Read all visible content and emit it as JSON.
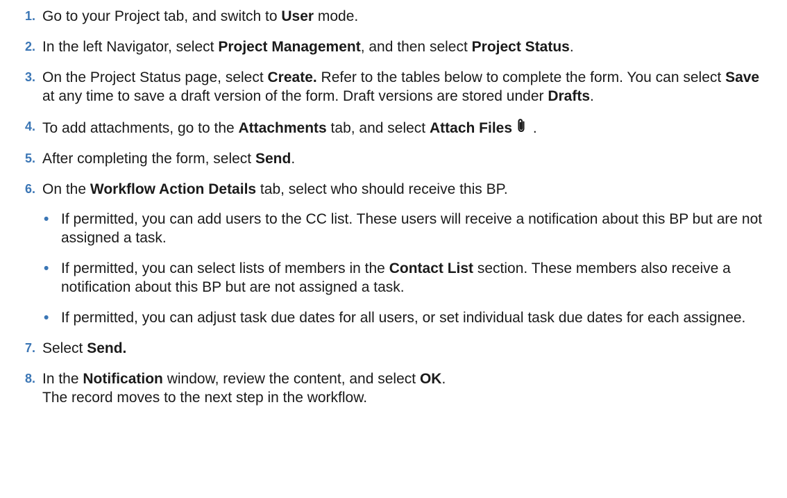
{
  "steps": [
    {
      "num": "1.",
      "parts": [
        "Go to your Project tab, and switch to ",
        "User",
        " mode."
      ]
    },
    {
      "num": "2.",
      "parts": [
        "In the left Navigator, select ",
        "Project Management",
        ", and then select ",
        "Project Status",
        "."
      ]
    },
    {
      "num": "3.",
      "parts": [
        "On the Project Status page, select ",
        "Create.",
        " Refer to the tables below to complete the form. You can select ",
        "Save",
        " at any time to save a draft version of the form. Draft versions are stored under ",
        "Drafts",
        "."
      ]
    },
    {
      "num": "4.",
      "parts": [
        "To add attachments, go to the ",
        "Attachments",
        " tab, and select ",
        "Attach Files",
        " ."
      ],
      "icon": "paperclip-icon"
    },
    {
      "num": "5.",
      "parts": [
        "After completing the form, select ",
        "Send",
        "."
      ]
    },
    {
      "num": "6.",
      "parts": [
        "On the ",
        "Workflow Action Details",
        " tab, select who should receive this BP."
      ],
      "bullet": "•",
      "subs": [
        {
          "parts": [
            "If permitted, you can add users to the CC list. These users will receive a notification about this BP but are not assigned a task."
          ]
        },
        {
          "parts": [
            "If permitted, you can select lists of members in the ",
            "Contact List",
            " section. These members also receive a notification about this BP but are not assigned a task."
          ]
        },
        {
          "parts": [
            "If permitted, you can adjust task due dates for all users, or set individual task due dates for each assignee."
          ]
        }
      ]
    },
    {
      "num": "7.",
      "parts": [
        "Select ",
        "Send."
      ]
    },
    {
      "num": "8.",
      "parts": [
        "In the ",
        "Notification",
        " window, review the content, and select ",
        "OK",
        "."
      ],
      "result": "The record moves to the next step in the workflow."
    }
  ],
  "colors": {
    "step_number": "#3b76b5",
    "text": "#1a1a1a"
  }
}
